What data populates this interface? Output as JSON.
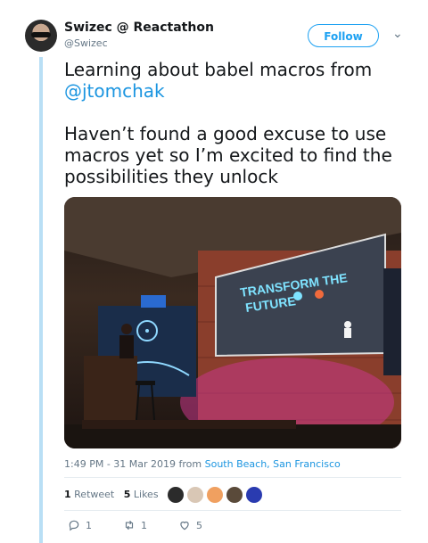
{
  "author": {
    "name": "Swizec @ Reactathon",
    "handle": "@Swizec"
  },
  "follow_label": "Follow",
  "tweet": {
    "line1": "Learning about babel macros from",
    "mention": "@jtomchak",
    "line2": "Haven’t found a good excuse to use macros yet so I’m excited to find the possibilities they unlock"
  },
  "photo": {
    "slide_title_line1": "TRANSFORM THE",
    "slide_title_line2": "FUTURE"
  },
  "meta": {
    "time": "1:49 PM - 31 Mar 2019 from",
    "location": "South Beach, San Francisco"
  },
  "stats": {
    "retweets_count": "1",
    "retweets_label": "Retweet",
    "likes_count": "5",
    "likes_label": "Likes"
  },
  "likers": [
    "#2b2b2b",
    "#d9c7b5",
    "#f0a060",
    "#5a4a3a",
    "#2a3bb0"
  ],
  "actions": {
    "replies": "1",
    "retweets": "1",
    "likes": "5"
  },
  "colors": {
    "accent": "#1da1f2",
    "thread": "#b9dff5"
  }
}
